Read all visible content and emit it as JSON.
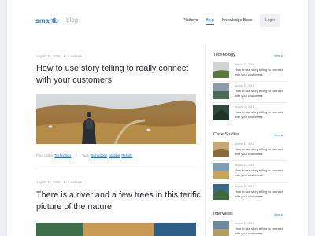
{
  "header": {
    "logo": "smartb",
    "logo_sub": "blog",
    "nav": [
      "Platform",
      "Blog",
      "Knowledge Base"
    ],
    "login": "Login"
  },
  "posts": [
    {
      "date": "August 15, 2016",
      "read": "4 min read",
      "title": "How to use story telling to really connect with your customers",
      "filed_label": "Filed under:",
      "filed_value": "Technology",
      "tags_label": "Tags:",
      "tags": [
        "Technology",
        "Bidding",
        "Results"
      ]
    },
    {
      "date": "August 15, 2016",
      "read": "4 min read",
      "title": "There is a river and a few trees in this terific picture of the nature"
    }
  ],
  "sidebar": {
    "view_all": "View all",
    "sections": [
      {
        "title": "Technology",
        "items": [
          {
            "date": "August 15, 2016",
            "text": "How to use story telling to connect with your customers"
          },
          {
            "date": "August 15, 2016",
            "text": "How to use story telling to connect with your customers"
          },
          {
            "date": "August 15, 2016",
            "text": "How to use story telling to connect with your customers"
          }
        ]
      },
      {
        "title": "Case Studies",
        "items": [
          {
            "date": "August 15, 2016",
            "text": "How to use story telling to connect with your customers"
          },
          {
            "date": "August 15, 2016",
            "text": "How to use story telling to connect with your customers"
          },
          {
            "date": "August 15, 2016",
            "text": "How to use story telling to connect with your customers"
          }
        ]
      },
      {
        "title": "Interviews",
        "items": [
          {
            "date": "August 15, 2016",
            "text": "How to use story telling to connect with your customers"
          }
        ]
      }
    ]
  },
  "colors": {
    "accent": "#1a73d9",
    "muted": "#9aa1aa",
    "background": "#eef0f3"
  }
}
